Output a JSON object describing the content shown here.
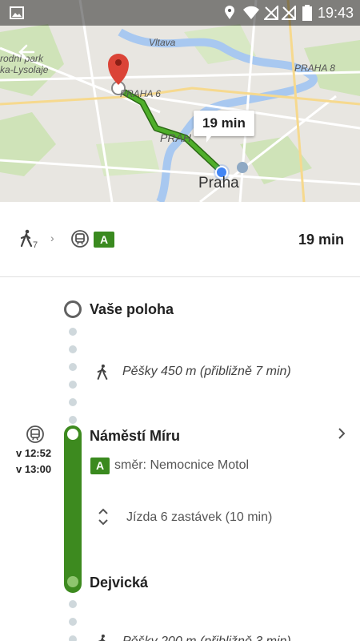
{
  "status_bar": {
    "time": "19:43"
  },
  "map": {
    "labels": {
      "park": "rodní park",
      "park2": "ka-Lysolaje",
      "river": "Vltava",
      "district6": "PRAHA 6",
      "district8": "PRAHA 8",
      "district_short": "PRAH",
      "city": "Praha"
    },
    "eta": "19 min"
  },
  "summary": {
    "walk_minutes": "7",
    "line": "A",
    "total": "19 min"
  },
  "timeline": {
    "origin": "Vaše poloha",
    "walk1": "Pěšky 450 m (přibližně 7 min)",
    "board_stop": "Náměstí Míru",
    "depart_time": "v 12:52",
    "arrive_time": "v 13:00",
    "line": "A",
    "direction": "směr: Nemocnice Motol",
    "ride": "Jízda 6 zastávek (10 min)",
    "alight_stop": "Dejvická",
    "walk2": "Pěšky 200 m (přibližně 3 min)"
  },
  "colors": {
    "line_green": "#3d8a1f",
    "route_green": "#3d8a1f",
    "location_blue": "#4285f4",
    "pin_red": "#db4437"
  }
}
